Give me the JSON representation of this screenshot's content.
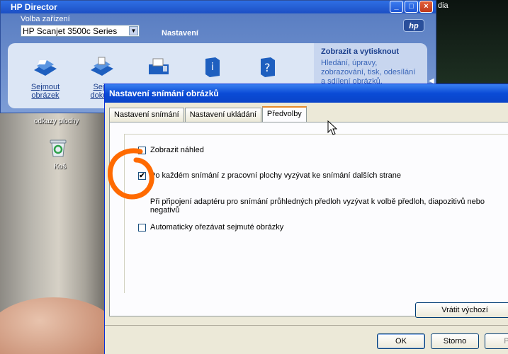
{
  "desktop": {
    "shortcut_label": "odkazy plochy",
    "recycle_label": "Koš",
    "right_text": "dia"
  },
  "hp_window": {
    "title": "HP Director",
    "device_label": "Volba zařízení",
    "device_value": "HP Scanjet 3500c Series",
    "settings_link": "Nastavení",
    "logo": "hp",
    "tools": [
      {
        "label1": "Sejmout",
        "label2": "obrázek",
        "icon": "scanner-picture-icon"
      },
      {
        "label1": "Sejm",
        "label2": "dokum",
        "icon": "scanner-document-icon"
      },
      {
        "label1": "",
        "label2": "",
        "icon": "fax-printer-icon"
      },
      {
        "label1": "",
        "label2": "",
        "icon": "info-book-icon"
      },
      {
        "label1": "",
        "label2": "",
        "icon": "help-icon"
      }
    ],
    "info_title": "Zobrazit a vytisknout",
    "info_text": "Hledání, úpravy, zobrazování, tisk, odesílání a sdílení obrázků."
  },
  "dialog": {
    "title": "Nastavení snímání obrázků",
    "tabs": [
      "Nastavení snímání",
      "Nastavení ukládání",
      "Předvolby"
    ],
    "active_tab": 2,
    "options": [
      {
        "label": "Zobrazit náhled",
        "checked": false
      },
      {
        "label": "Po každém snímání z pracovní plochy vyzývat ke snímání dalších strane",
        "checked": true
      },
      {
        "label": "Při připojení adaptéru pro snímání průhledných předloh vyzývat k volbě předloh, diapozitivů nebo negativů",
        "checked": false
      },
      {
        "label": "Automaticky ořezávat sejmuté obrázky",
        "checked": false
      }
    ],
    "restore_button": "Vrátit výchozí",
    "ok_button": "OK",
    "cancel_button": "Storno",
    "apply_button": "Po"
  },
  "colors": {
    "annotation": "#ff6a00",
    "titlebar": "#0a4bd6"
  }
}
